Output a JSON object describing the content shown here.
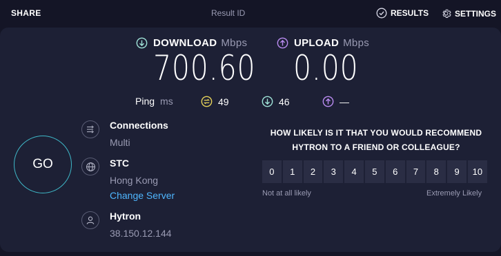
{
  "topbar": {
    "share": "SHARE",
    "result_id": "Result ID",
    "results": "RESULTS",
    "settings": "SETTINGS"
  },
  "download": {
    "label": "DOWNLOAD",
    "unit": "Mbps",
    "value": "700.60"
  },
  "upload": {
    "label": "UPLOAD",
    "unit": "Mbps",
    "value": "0.00"
  },
  "ping": {
    "label": "Ping",
    "unit": "ms",
    "idle": "49",
    "down": "46",
    "up": "—"
  },
  "go": "GO",
  "connections": {
    "title": "Connections",
    "value": "Multi"
  },
  "server": {
    "title": "STC",
    "location": "Hong Kong",
    "change": "Change Server"
  },
  "provider": {
    "title": "Hytron",
    "ip": "38.150.12.144"
  },
  "survey": {
    "question_line1": "HOW LIKELY IS IT THAT YOU WOULD RECOMMEND",
    "question_line2": "HYTRON TO A FRIEND OR COLLEAGUE?",
    "scale": [
      "0",
      "1",
      "2",
      "3",
      "4",
      "5",
      "6",
      "7",
      "8",
      "9",
      "10"
    ],
    "low_label": "Not at all likely",
    "high_label": "Extremely Likely"
  },
  "colors": {
    "accent_teal": "#3fb9c9",
    "download": "#9fe3d8",
    "upload": "#b98bf0",
    "ping_idle": "#e7d35a",
    "link": "#4fb6ff"
  }
}
